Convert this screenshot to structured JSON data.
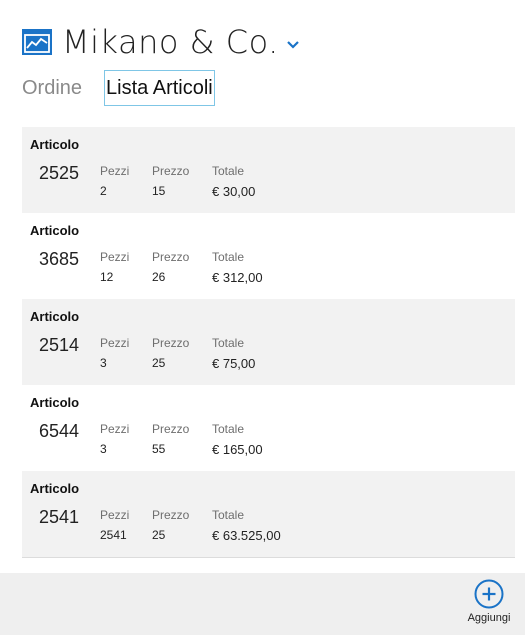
{
  "header": {
    "title": "Mikano & Co.",
    "icon": "chart-window-icon",
    "dropdown_icon": "chevron-down-icon"
  },
  "tabs": [
    {
      "label": "Ordine",
      "active": false
    },
    {
      "label": "Lista Articoli",
      "active": true
    }
  ],
  "items": [
    {
      "heading": "Articolo",
      "code": "2525",
      "pezzi_label": "Pezzi",
      "pezzi": "2",
      "prezzo_label": "Prezzo",
      "prezzo": "15",
      "totale_label": "Totale",
      "totale": "€ 30,00"
    },
    {
      "heading": "Articolo",
      "code": "3685",
      "pezzi_label": "Pezzi",
      "pezzi": "12",
      "prezzo_label": "Prezzo",
      "prezzo": "26",
      "totale_label": "Totale",
      "totale": "€ 312,00"
    },
    {
      "heading": "Articolo",
      "code": "2514",
      "pezzi_label": "Pezzi",
      "pezzi": "3",
      "prezzo_label": "Prezzo",
      "prezzo": "25",
      "totale_label": "Totale",
      "totale": "€ 75,00"
    },
    {
      "heading": "Articolo",
      "code": "6544",
      "pezzi_label": "Pezzi",
      "pezzi": "3",
      "prezzo_label": "Prezzo",
      "prezzo": "55",
      "totale_label": "Totale",
      "totale": "€ 165,00"
    },
    {
      "heading": "Articolo",
      "code": "2541",
      "pezzi_label": "Pezzi",
      "pezzi": "2541",
      "prezzo_label": "Prezzo",
      "prezzo": "25",
      "totale_label": "Totale",
      "totale": "€ 63.525,00"
    }
  ],
  "appbar": {
    "add_label": "Aggiungi",
    "add_icon": "plus-circle-icon"
  },
  "colors": {
    "accent": "#1a73c7",
    "tab_border": "#7fc6e6",
    "row_shade": "#f2f2f2",
    "appbar_bg": "#efefef"
  }
}
